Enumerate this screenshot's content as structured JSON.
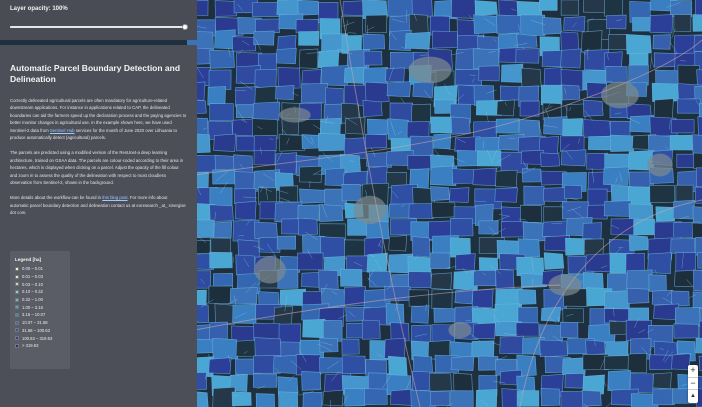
{
  "layer_control": {
    "opacity_label": "Layer opacity: 100%",
    "opacity_value": 1.0
  },
  "info_panel": {
    "title": "Automatic Parcel Boundary Detection and Delineation",
    "paragraph1": "Correctly delineated agricultural parcels are often mandatory for agriculture-related downstream applications. For instance in applications related to CAP, the delineated boundaries can aid the farmers speed up the declaration process and the paying agencies to better monitor changes in agricultural use. In the example shown here, we have used Sentinel-2 data from Sentinel Hub services for the month of June 2020 over Lithuania to produce automatically detect (agricultural) parcels.",
    "paragraph1_link": "Sentinel Hub",
    "paragraph2": "The parcels are predicted using a modified version of the ResUnet-a deep learning architecture, trained on GSAA data. The parcels are colour-coded according to their area in hectares, which is displayed when clicking on a parcel. Adjust the opacity of the fill colour and zoom in to assess the quality of the delineation with respect to most cloudless observation from Sentinel-2, shown in the background.",
    "paragraph3_before": "More details about the workflow can be found in ",
    "paragraph3_link": "this blog post",
    "paragraph3_after": ". For more info about automatic parcel boundary detection and delineation contact us at eoresearch _at_ sinergise dot com."
  },
  "legend": {
    "title": "Legend [ha]",
    "items": [
      {
        "label": "0.00 – 0.01",
        "color": "#f3f4c8"
      },
      {
        "label": "0.01 – 0.03",
        "color": "#dbeec2"
      },
      {
        "label": "0.03 – 0.10",
        "color": "#b8e0c8"
      },
      {
        "label": "0.10 – 0.32",
        "color": "#8fd0d2"
      },
      {
        "label": "0.32 – 1.00",
        "color": "#67bcd6"
      },
      {
        "label": "1.00 – 3.16",
        "color": "#4aa6d2"
      },
      {
        "label": "3.16 – 10.07",
        "color": "#3a8ac6"
      },
      {
        "label": "10.07 – 31.68",
        "color": "#3570b8"
      },
      {
        "label": "31.68 – 100.63",
        "color": "#3056a8"
      },
      {
        "label": "100.63 – 319.63",
        "color": "#2c3e96"
      },
      {
        "label": "> 319.63",
        "color": "#262882"
      }
    ]
  },
  "map_controls": {
    "zoom_in": "+",
    "zoom_out": "−",
    "reset_north": "▲"
  }
}
